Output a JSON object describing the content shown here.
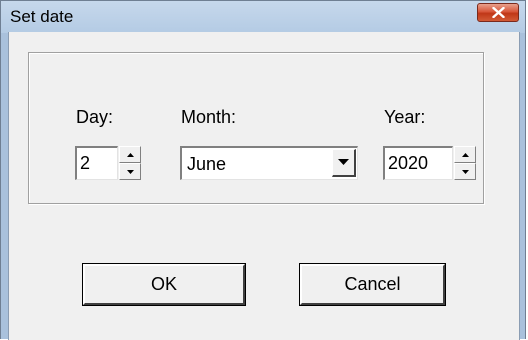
{
  "window": {
    "title": "Set date"
  },
  "titlebar": {
    "close_icon": "close-icon"
  },
  "form": {
    "day": {
      "label": "Day:",
      "value": "2"
    },
    "month": {
      "label": "Month:",
      "value": "June"
    },
    "year": {
      "label": "Year:",
      "value": "2020"
    }
  },
  "buttons": {
    "ok": "OK",
    "cancel": "Cancel"
  },
  "colors": {
    "close_button": "#c9432a",
    "titlebar": "#bcd1e8",
    "dialog_face": "#f0f0f0"
  }
}
